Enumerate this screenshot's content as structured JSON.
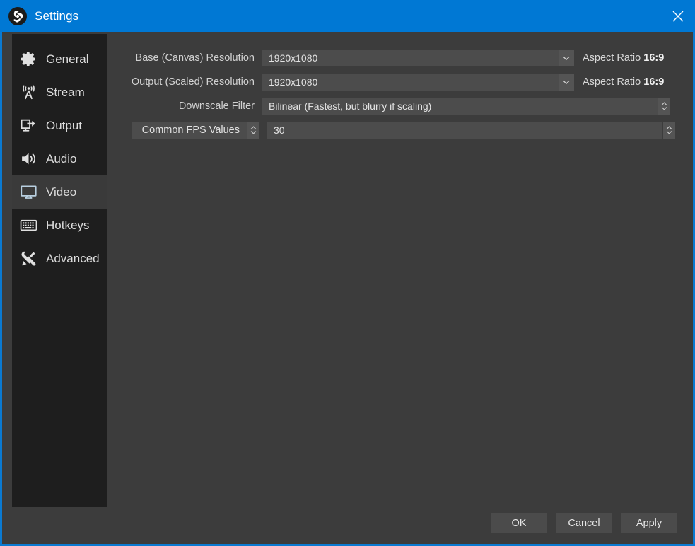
{
  "window": {
    "title": "Settings",
    "logo_icon": "obs-logo-icon",
    "close_icon": "close-icon",
    "accent_color": "#0078d4",
    "border_color": "#0b7ad1",
    "background_color": "#3c3c3c",
    "sidebar_color": "#1e1e1e",
    "field_color": "#4c4c4c"
  },
  "sidebar": {
    "items": [
      {
        "label": "General",
        "icon": "gear-icon",
        "selected": false
      },
      {
        "label": "Stream",
        "icon": "broadcast-icon",
        "selected": false
      },
      {
        "label": "Output",
        "icon": "output-monitor-icon",
        "selected": false
      },
      {
        "label": "Audio",
        "icon": "speaker-icon",
        "selected": false
      },
      {
        "label": "Video",
        "icon": "monitor-icon",
        "selected": true
      },
      {
        "label": "Hotkeys",
        "icon": "keyboard-icon",
        "selected": false
      },
      {
        "label": "Advanced",
        "icon": "tools-icon",
        "selected": false
      }
    ]
  },
  "form": {
    "rows": [
      {
        "label": "Base (Canvas) Resolution",
        "value": "1920x1080",
        "control": "combobox",
        "control_icon": "chevron-down-icon",
        "suffix_label": "Aspect Ratio",
        "suffix_value": "16:9"
      },
      {
        "label": "Output (Scaled) Resolution",
        "value": "1920x1080",
        "control": "combobox",
        "control_icon": "chevron-down-icon",
        "suffix_label": "Aspect Ratio",
        "suffix_value": "16:9"
      },
      {
        "label": "Downscale Filter",
        "value": "Bilinear (Fastest, but blurry if scaling)",
        "control": "spinbox",
        "control_icon": "spinner-arrows-icon",
        "suffix_label": "",
        "suffix_value": ""
      }
    ],
    "fps_row": {
      "mode_label": "Common FPS Values",
      "mode_icon": "spinner-arrows-icon",
      "value": "30",
      "control_icon": "spinner-arrows-icon"
    }
  },
  "footer": {
    "ok_label": "OK",
    "cancel_label": "Cancel",
    "apply_label": "Apply"
  }
}
